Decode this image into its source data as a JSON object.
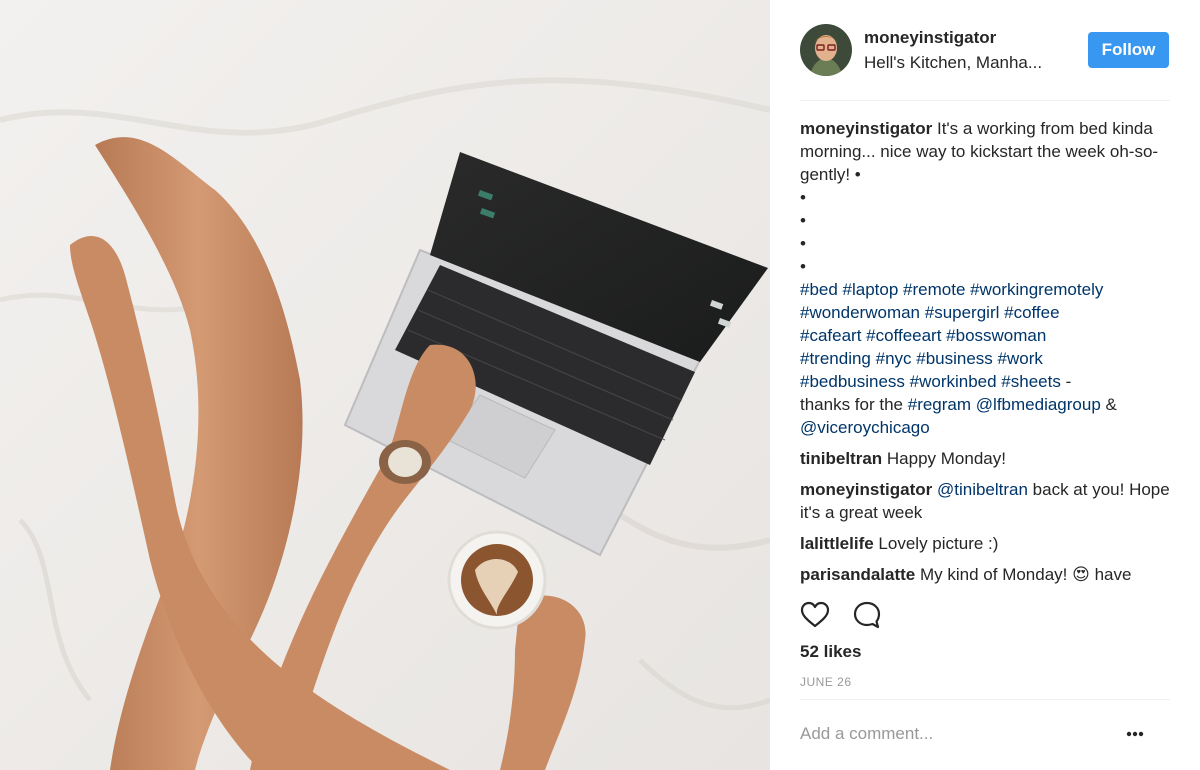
{
  "post": {
    "username": "moneyinstigator",
    "location": "Hell's Kitchen, Manha...",
    "follow_label": "Follow",
    "caption": {
      "user": "moneyinstigator",
      "text": "It's a working from bed kinda morning... nice way to kickstart the week oh-so-gently! •",
      "bullets": [
        "•",
        "•",
        "•",
        "•"
      ],
      "hashtags_line1": "#bed #laptop #remote #workingremotely",
      "hashtags_line2": "#wonderwoman #supergirl #coffee",
      "hashtags_line3": "#cafeart #coffeeart #bosswoman",
      "hashtags_line4": "#trending #nyc #business #work",
      "hashtags_line5": "#bedbusiness #workinbed #sheets",
      "dash": " -",
      "thanks_text": "thanks for the ",
      "regram": "#regram",
      "mention1": "@lfbmediagroup",
      "amp": " &",
      "mention2": "@viceroychicago"
    },
    "comments": [
      {
        "user": "tinibeltran",
        "text": "Happy Monday!"
      },
      {
        "user": "moneyinstigator",
        "mention": "@tinibeltran",
        "text": " back at you! Hope it's a great week"
      },
      {
        "user": "lalittlelife",
        "text": "Lovely picture :)"
      },
      {
        "user": "parisandalatte",
        "text": "My kind of Monday! 😍 have"
      }
    ],
    "likes": "52 likes",
    "date": "JUNE 26",
    "add_comment_placeholder": "Add a comment...",
    "icons": {
      "like": "heart-icon",
      "comment": "comment-bubble-icon",
      "more": "more-options-icon"
    },
    "colors": {
      "follow_bg": "#3897f0",
      "link": "#003569",
      "muted": "#999999"
    }
  }
}
